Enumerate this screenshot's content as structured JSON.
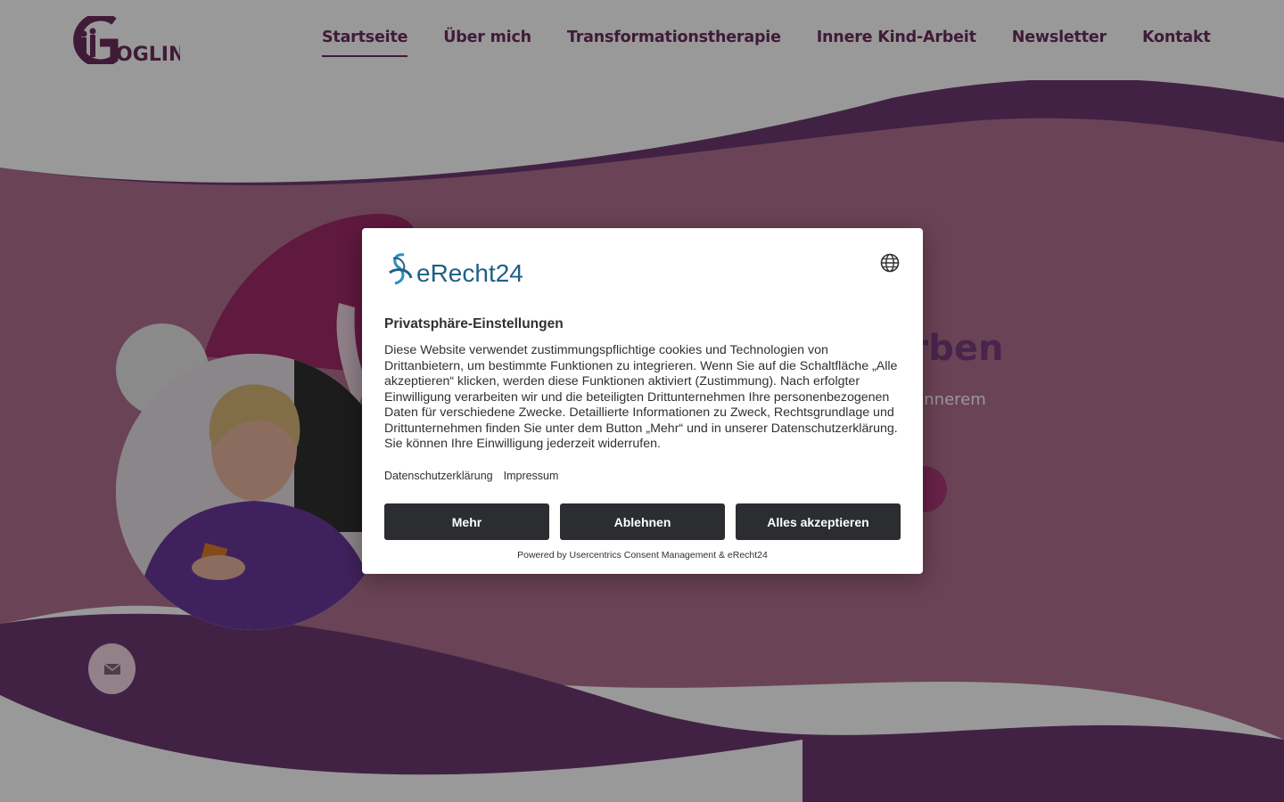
{
  "header": {
    "logo_text": "GOGLIN",
    "nav": [
      {
        "label": "Startseite",
        "active": true
      },
      {
        "label": "Über mich",
        "active": false
      },
      {
        "label": "Transformationstherapie",
        "active": false
      },
      {
        "label": "Innere Kind-Arbeit",
        "active": false
      },
      {
        "label": "Newsletter",
        "active": false
      },
      {
        "label": "Kontakt",
        "active": false
      }
    ]
  },
  "hero": {
    "title_visible": "en Farben",
    "subtitle_visible": "hr Freude und innerem"
  },
  "contact_fab": {
    "icon": "envelope-icon"
  },
  "consent": {
    "brand": "eRecht24",
    "language_icon": "globe-icon",
    "title": "Privatsphäre-Einstellungen",
    "body": "Diese Website verwendet zustimmungspflichtige cookies und Technologien von Drittanbietern, um bestimmte Funktionen zu integrieren. Wenn Sie auf die Schaltfläche „Alle akzeptieren“ klicken, werden diese Funktionen aktiviert (Zustimmung). Nach erfolgter Einwilligung verarbeiten wir und die beteiligten Drittunternehmen Ihre personenbezogenen Daten für verschiedene Zwecke. Detaillierte Informationen zu Zweck, Rechtsgrundlage und Drittunternehmen finden Sie unter dem Button „Mehr“ und in unserer Datenschutzerklärung. Sie können Ihre Einwilligung jederzeit widerrufen.",
    "links": {
      "privacy": "Datenschutzerklärung",
      "imprint": "Impressum"
    },
    "buttons": {
      "more": "Mehr",
      "reject": "Ablehnen",
      "accept_all": "Alles akzeptieren"
    },
    "powered_by": "Powered by Usercentrics Consent Management & eRecht24"
  },
  "colors": {
    "brand_purple": "#6b2d5e",
    "wave_dark": "#6f3a72",
    "wave_pink": "#b3708f",
    "button_dark": "#2b2d30",
    "erecht_blue": "#1f5f86"
  }
}
